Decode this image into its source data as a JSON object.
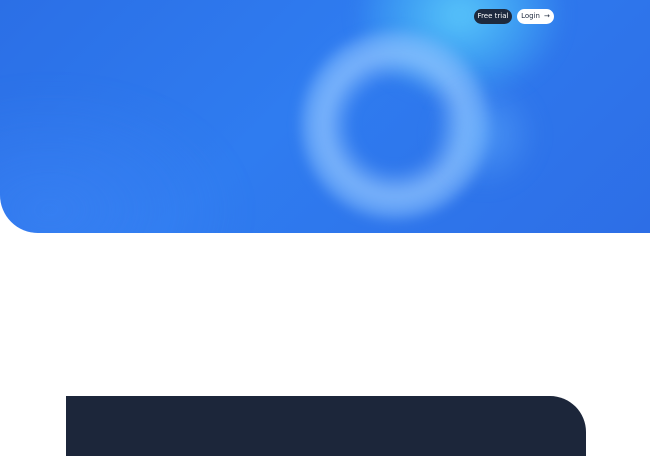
{
  "header": {
    "free_trial_label": "Free trial",
    "login_label": "Login",
    "login_arrow": "→"
  },
  "colors": {
    "hero_blue": "#2d6ee6",
    "dark_navy": "#1c263a",
    "white": "#ffffff"
  },
  "icons": {
    "login_arrow_icon": "arrow-right-icon"
  }
}
